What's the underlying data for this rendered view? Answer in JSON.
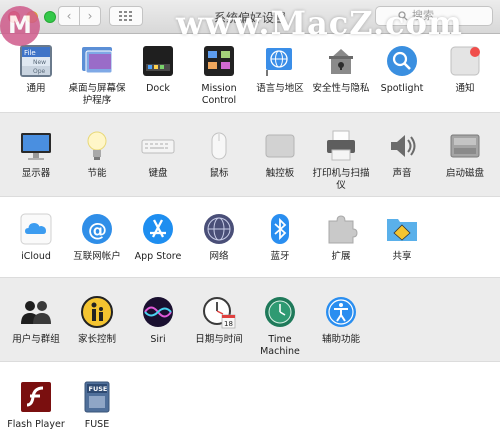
{
  "window": {
    "title": "系统偏好设置",
    "search_placeholder": "搜索",
    "nav_back": "‹",
    "nav_forward": "›"
  },
  "watermark": {
    "logo_letter": "M",
    "text": "www.MacZ.com"
  },
  "rows": [
    {
      "items": [
        {
          "label": "通用",
          "icon": "general-icon",
          "badge": {
            "file": "File",
            "new": "New",
            "ope": "Ope"
          }
        },
        {
          "label": "桌面与屏幕保护程序",
          "icon": "desktop-screensaver-icon"
        },
        {
          "label": "Dock",
          "icon": "dock-icon"
        },
        {
          "label": "Mission Control",
          "icon": "mission-control-icon"
        },
        {
          "label": "语言与地区",
          "icon": "language-region-icon"
        },
        {
          "label": "安全性与隐私",
          "icon": "security-privacy-icon"
        },
        {
          "label": "Spotlight",
          "icon": "spotlight-icon"
        },
        {
          "label": "通知",
          "icon": "notifications-icon"
        }
      ]
    },
    {
      "items": [
        {
          "label": "显示器",
          "icon": "displays-icon"
        },
        {
          "label": "节能",
          "icon": "energy-saver-icon"
        },
        {
          "label": "键盘",
          "icon": "keyboard-icon"
        },
        {
          "label": "鼠标",
          "icon": "mouse-icon"
        },
        {
          "label": "触控板",
          "icon": "trackpad-icon"
        },
        {
          "label": "打印机与扫描仪",
          "icon": "printers-scanners-icon"
        },
        {
          "label": "声音",
          "icon": "sound-icon"
        },
        {
          "label": "启动磁盘",
          "icon": "startup-disk-icon"
        }
      ]
    },
    {
      "items": [
        {
          "label": "iCloud",
          "icon": "icloud-icon"
        },
        {
          "label": "互联网帐户",
          "icon": "internet-accounts-icon"
        },
        {
          "label": "App Store",
          "icon": "app-store-icon"
        },
        {
          "label": "网络",
          "icon": "network-icon"
        },
        {
          "label": "蓝牙",
          "icon": "bluetooth-icon"
        },
        {
          "label": "扩展",
          "icon": "extensions-icon"
        },
        {
          "label": "共享",
          "icon": "sharing-icon"
        }
      ]
    },
    {
      "items": [
        {
          "label": "用户与群组",
          "icon": "users-groups-icon"
        },
        {
          "label": "家长控制",
          "icon": "parental-controls-icon"
        },
        {
          "label": "Siri",
          "icon": "siri-icon"
        },
        {
          "label": "日期与时间",
          "icon": "date-time-icon",
          "calendar_day": "18"
        },
        {
          "label": "Time Machine",
          "icon": "time-machine-icon"
        },
        {
          "label": "辅助功能",
          "icon": "accessibility-icon"
        }
      ]
    },
    {
      "items": [
        {
          "label": "Flash Player",
          "icon": "flash-player-icon"
        },
        {
          "label": "FUSE",
          "icon": "fuse-icon",
          "badge_text": "FUSE"
        }
      ]
    }
  ],
  "colors": {
    "accent_red_arrow": "#e0413f",
    "alternate_row": "#ececec",
    "notification_dot": "#f04e4b"
  }
}
